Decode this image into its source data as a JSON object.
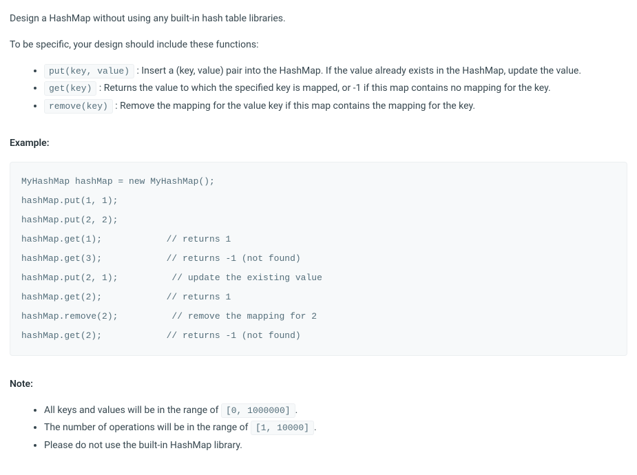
{
  "intro": {
    "line1": "Design a HashMap without using any built-in hash table libraries.",
    "line2": "To be specific, your design should include these functions:"
  },
  "functions": [
    {
      "code": "put(key, value)",
      "desc": " : Insert a (key, value) pair into the HashMap. If the value already exists in the HashMap, update the value."
    },
    {
      "code": "get(key)",
      "desc": " : Returns the value to which the specified key is mapped, or -1 if this map contains no mapping for the key."
    },
    {
      "code": "remove(key)",
      "desc": " : Remove the mapping for the value key if this map contains the mapping for the key."
    }
  ],
  "example": {
    "heading": "Example:",
    "code": "MyHashMap hashMap = new MyHashMap();\nhashMap.put(1, 1);          \nhashMap.put(2, 2);         \nhashMap.get(1);            // returns 1\nhashMap.get(3);            // returns -1 (not found)\nhashMap.put(2, 1);          // update the existing value\nhashMap.get(2);            // returns 1 \nhashMap.remove(2);          // remove the mapping for 2\nhashMap.get(2);            // returns -1 (not found) "
  },
  "note": {
    "heading": "Note:",
    "items": [
      {
        "prefix": "All keys and values will be in the range of ",
        "code": "[0, 1000000]",
        "suffix": "."
      },
      {
        "prefix": "The number of operations will be in the range of ",
        "code": "[1, 10000]",
        "suffix": "."
      },
      {
        "prefix": "Please do not use the built-in HashMap library.",
        "code": "",
        "suffix": ""
      }
    ]
  }
}
